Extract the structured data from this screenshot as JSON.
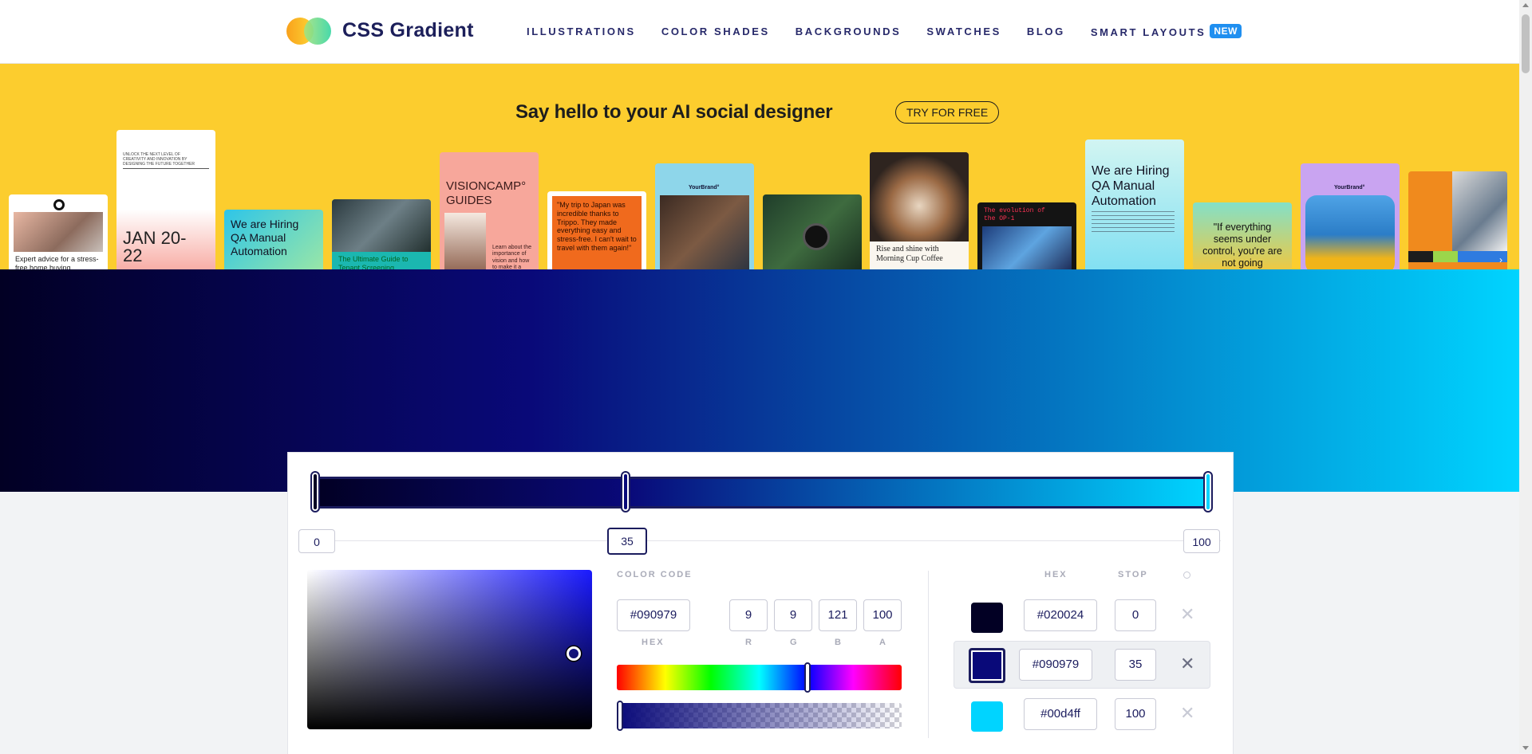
{
  "header": {
    "brand": "CSS Gradient",
    "nav": [
      "ILLUSTRATIONS",
      "COLOR SHADES",
      "BACKGROUNDS",
      "SWATCHES",
      "BLOG",
      "SMART LAYOUTS"
    ],
    "nav_badge": "NEW"
  },
  "banner": {
    "title": "Say hello to your AI social designer",
    "cta": "TRY FOR FREE",
    "cards": [
      "Expert advice for a stress-free home buying experience",
      "UNLOCK THE NEXT LEVEL OF CREATIVITY AND INNOVATION BY DESIGNING THE FUTURE TOGETHER",
      "JAN 20-22",
      "We are Hiring QA Manual Automation",
      "The Ultimate Guide to Tenant Screening",
      "VISIONCAMP° GUIDES",
      "Learn about the importance of vision and how to make it a",
      "\"My trip to Japan was incredible thanks to Trippo. They made everything easy and stress-free. I can't wait to travel with them again!\"",
      "YourBrand°",
      "Rise and shine with Morning Cup Coffee",
      "The evolution of the OP-1",
      "We are Hiring QA Manual Automation",
      "\"If everything seems under control, you're are not going",
      "YourBrand°"
    ]
  },
  "gradient": {
    "stops": [
      {
        "hex": "#020024",
        "stop": "0"
      },
      {
        "hex": "#090979",
        "stop": "35"
      },
      {
        "hex": "#00d4ff",
        "stop": "100"
      }
    ]
  },
  "editor": {
    "positions": [
      "0",
      "35",
      "100"
    ],
    "color_code_label": "COLOR CODE",
    "hex_value": "#090979",
    "r": "9",
    "g": "9",
    "b": "121",
    "a": "100",
    "labels": {
      "hex": "HEX",
      "r": "R",
      "g": "G",
      "b": "B",
      "a": "A"
    },
    "table_headers": {
      "hex": "HEX",
      "stop": "STOP"
    },
    "hue_level_percent": 67,
    "alpha_level_percent": 0
  }
}
